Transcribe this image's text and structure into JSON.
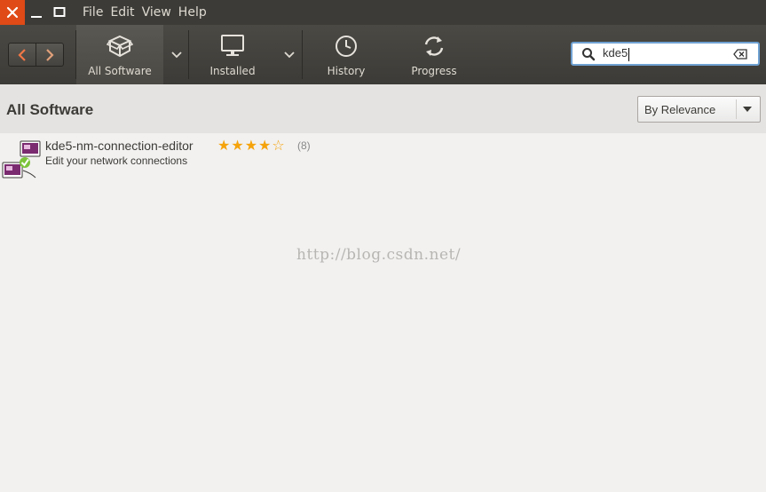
{
  "window": {
    "menu": [
      "File",
      "Edit",
      "View",
      "Help"
    ]
  },
  "toolbar": {
    "back_icon": "chevron-left-icon",
    "forward_icon": "chevron-right-icon",
    "all_software": "All Software",
    "installed": "Installed",
    "history": "History",
    "progress": "Progress"
  },
  "search": {
    "value": "kde5"
  },
  "header": {
    "title": "All Software",
    "sort": "By Relevance"
  },
  "results": [
    {
      "name": "kde5-nm-connection-editor",
      "description": "Edit your network connections",
      "rating": 4,
      "rating_max": 5,
      "reviews": "(8)"
    }
  ],
  "watermark": "http://blog.csdn.net/",
  "colors": {
    "accent_close": "#df4a16",
    "toolbar": "#3c3b37",
    "star": "#f5a30b",
    "search_focus": "#6fa1d2"
  }
}
